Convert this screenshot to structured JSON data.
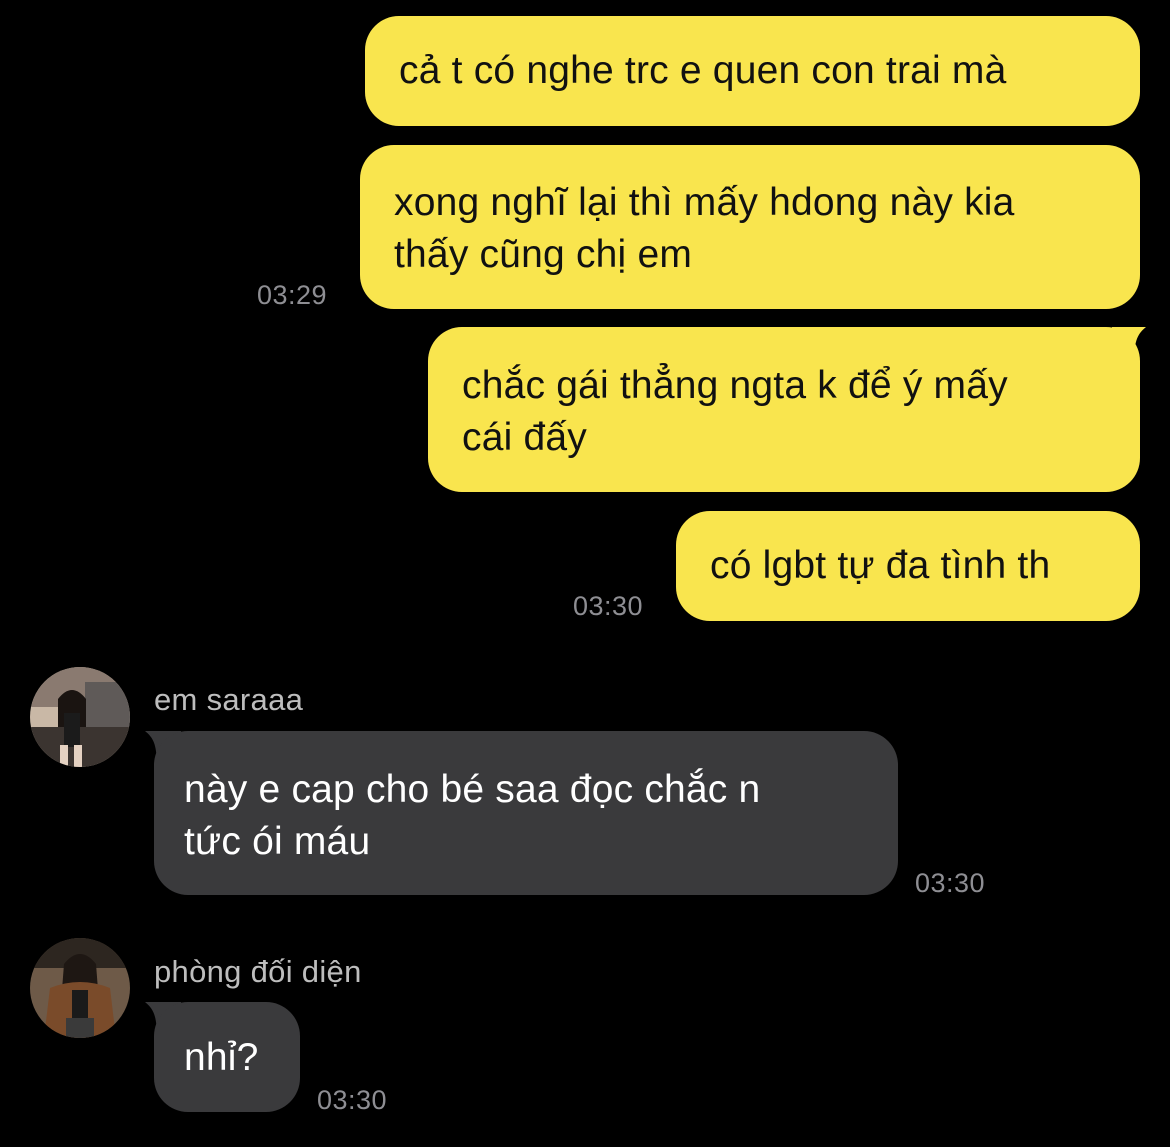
{
  "outgoing": [
    {
      "lines": [
        "cả t có nghe trc e quen con trai mà"
      ]
    },
    {
      "lines": [
        "xong nghĩ lại thì mấy hdong này kia",
        "thấy cũng chị em"
      ],
      "time": "03:29"
    },
    {
      "lines": [
        "chắc gái thẳng ngta k để ý mấy",
        "cái đấy"
      ]
    },
    {
      "lines": [
        "có lgbt tự đa tình th"
      ],
      "time": "03:30"
    }
  ],
  "incoming": [
    {
      "sender": "em saraaa",
      "avatar_icon": "avatar-photo-icon",
      "lines": [
        "này e cap cho bé saa đọc chắc n",
        "tức ói máu"
      ],
      "time": "03:30"
    },
    {
      "sender": "phòng đối diện",
      "avatar_icon": "avatar-photo-icon",
      "lines": [
        "nhỉ?"
      ],
      "time": "03:30"
    }
  ],
  "colors": {
    "background": "#000000",
    "outgoing_bubble": "#f9e54e",
    "incoming_bubble": "#3a3a3c",
    "timestamp": "#8e8e93"
  }
}
